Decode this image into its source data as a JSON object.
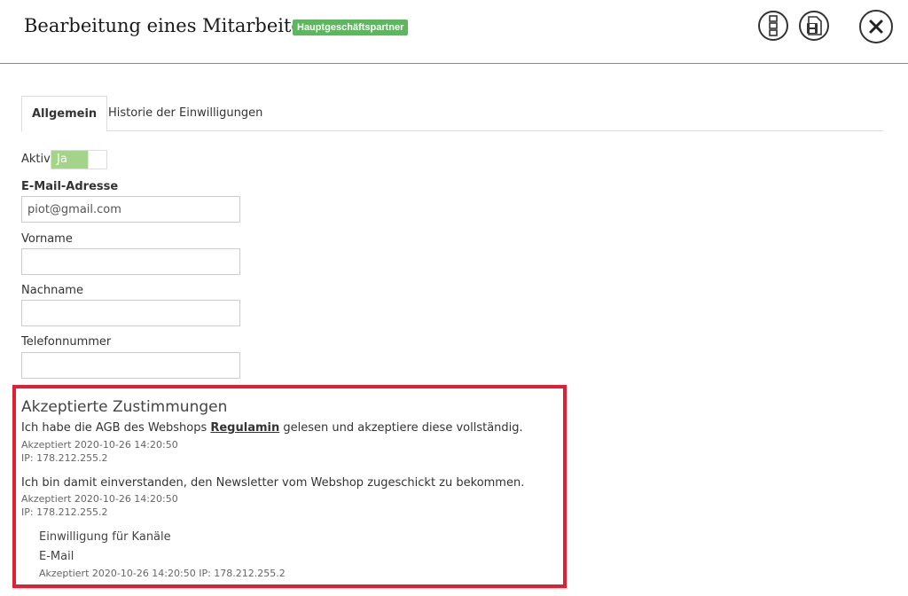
{
  "header": {
    "title": "Bearbeitung eines Mitarbeiters",
    "badge": "Hauptgeschäftspartner"
  },
  "tabs": [
    {
      "label": "Allgemein",
      "active": true
    },
    {
      "label": "Historie der Einwilligungen",
      "active": false
    }
  ],
  "form": {
    "active_label": "Aktiv",
    "active_toggle": "Ja",
    "email_label": "E-Mail-Adresse",
    "email_value": "piot@gmail.com",
    "firstname_label": "Vorname",
    "firstname_value": "",
    "lastname_label": "Nachname",
    "lastname_value": "",
    "phone_label": "Telefonnummer",
    "phone_value": ""
  },
  "consents": {
    "title": "Akzeptierte Zustimmungen",
    "items": [
      {
        "text_before": "Ich habe die AGB des Webshops ",
        "link": "Regulamin",
        "text_after": " gelesen und akzeptiere diese vollständig.",
        "accepted": "Akzeptiert 2020-10-26 14:20:50",
        "ip": "IP: 178.212.255.2"
      },
      {
        "text": "Ich bin damit einverstanden, den Newsletter vom Webshop zugeschickt zu bekommen.",
        "accepted": "Akzeptiert 2020-10-26 14:20:50",
        "ip": "IP: 178.212.255.2"
      }
    ],
    "channels": {
      "title": "Einwilligung für Kanäle",
      "channel": "E-Mail",
      "meta": "Akzeptiert 2020-10-26 14:20:50 IP: 178.212.255.2"
    }
  },
  "colors": {
    "badge": "#5cb85c",
    "toggle_on": "#a3d48a",
    "highlight": "#e02032"
  },
  "icons": {
    "menu": "menu-icon",
    "save": "save-icon",
    "close": "close-icon"
  }
}
